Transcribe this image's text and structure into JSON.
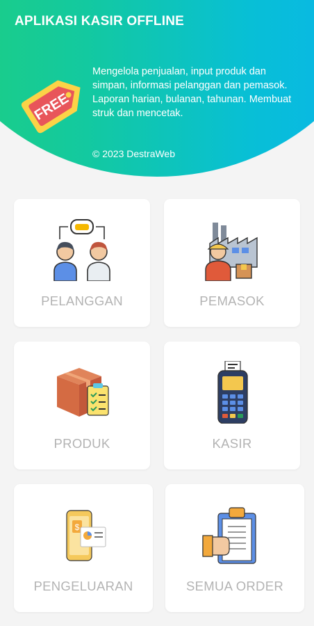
{
  "header": {
    "title": "APLIKASI KASIR OFFLINE",
    "badge_text": "FREE",
    "description": "Mengelola penjualan, input produk dan simpan, informasi pelanggan dan pemasok. Laporan harian, bulanan, tahunan. Membuat struk dan mencetak.",
    "copyright": "© 2023 DestraWeb"
  },
  "menu": [
    {
      "label": "PELANGGAN",
      "icon": "customers-icon"
    },
    {
      "label": "PEMASOK",
      "icon": "supplier-icon"
    },
    {
      "label": "PRODUK",
      "icon": "product-box-icon"
    },
    {
      "label": "KASIR",
      "icon": "payment-terminal-icon"
    },
    {
      "label": "PENGELUARAN",
      "icon": "expense-phone-icon"
    },
    {
      "label": "SEMUA ORDER",
      "icon": "order-clipboard-icon"
    }
  ]
}
